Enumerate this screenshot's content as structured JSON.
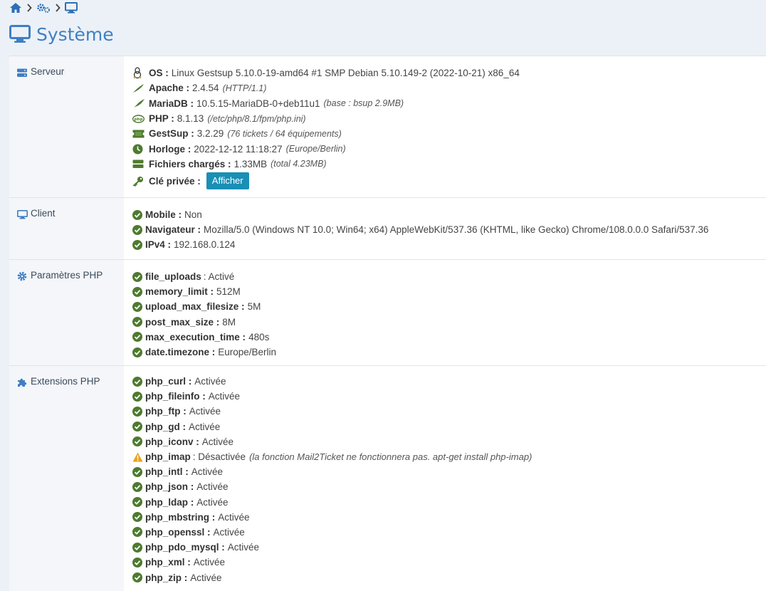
{
  "page_title": "Système",
  "sections": {
    "server": {
      "label": "Serveur",
      "rows": [
        {
          "key": "OS :",
          "value": "Linux Gestsup 5.10.0-19-amd64 #1 SMP Debian 5.10.149-2 (2022-10-21) x86_64",
          "note": "",
          "icon": "linux-icon"
        },
        {
          "key": "Apache :",
          "value": "2.4.54",
          "note": "(HTTP/1.1)",
          "icon": "apache-feather-icon"
        },
        {
          "key": "MariaDB :",
          "value": "10.5.15-MariaDB-0+deb11u1",
          "note": "(base : bsup 2.9MB)",
          "icon": "mariadb-icon"
        },
        {
          "key": "PHP :",
          "value": "8.1.13",
          "note": "(/etc/php/8.1/fpm/php.ini)",
          "icon": "php-icon"
        },
        {
          "key": "GestSup :",
          "value": "3.2.29",
          "note": "(76 tickets / 64 équipements)",
          "icon": "ticket-icon"
        },
        {
          "key": "Horloge :",
          "value": "2022-12-12 11:18:27",
          "note": "(Europe/Berlin)",
          "icon": "clock-icon"
        },
        {
          "key": "Fichiers chargés :",
          "value": "1.33MB",
          "note": "(total 4.23MB)",
          "icon": "hdd-icon"
        }
      ],
      "private_key_label": "Clé privée :",
      "show_button": "Afficher"
    },
    "client": {
      "label": "Client",
      "rows": [
        {
          "key": "Mobile :",
          "value": "Non"
        },
        {
          "key": "Navigateur :",
          "value": "Mozilla/5.0 (Windows NT 10.0; Win64; x64) AppleWebKit/537.36 (KHTML, like Gecko) Chrome/108.0.0.0 Safari/537.36"
        },
        {
          "key": "IPv4 :",
          "value": "192.168.0.124"
        }
      ]
    },
    "php_params": {
      "label": "Paramètres PHP",
      "rows": [
        {
          "key": "file_uploads",
          "value": ": Activé"
        },
        {
          "key": "memory_limit :",
          "value": "512M"
        },
        {
          "key": "upload_max_filesize :",
          "value": "5M"
        },
        {
          "key": "post_max_size :",
          "value": "8M"
        },
        {
          "key": "max_execution_time :",
          "value": "480s"
        },
        {
          "key": "date.timezone :",
          "value": "Europe/Berlin"
        }
      ]
    },
    "php_ext": {
      "label": "Extensions PHP",
      "rows": [
        {
          "key": "php_curl :",
          "value": "Activée",
          "status": "ok"
        },
        {
          "key": "php_fileinfo :",
          "value": "Activée",
          "status": "ok"
        },
        {
          "key": "php_ftp :",
          "value": "Activée",
          "status": "ok"
        },
        {
          "key": "php_gd :",
          "value": "Activée",
          "status": "ok"
        },
        {
          "key": "php_iconv :",
          "value": "Activée",
          "status": "ok"
        },
        {
          "key": "php_imap",
          "value": ": Désactivée",
          "note": "(la fonction Mail2Ticket ne fonctionnera pas. apt-get install php-imap)",
          "status": "warn"
        },
        {
          "key": "php_intl :",
          "value": "Activée",
          "status": "ok"
        },
        {
          "key": "php_json :",
          "value": "Activée",
          "status": "ok"
        },
        {
          "key": "php_ldap :",
          "value": "Activée",
          "status": "ok"
        },
        {
          "key": "php_mbstring :",
          "value": "Activée",
          "status": "ok"
        },
        {
          "key": "php_openssl :",
          "value": "Activée",
          "status": "ok"
        },
        {
          "key": "php_pdo_mysql :",
          "value": "Activée",
          "status": "ok"
        },
        {
          "key": "php_xml :",
          "value": "Activée",
          "status": "ok"
        },
        {
          "key": "php_zip :",
          "value": "Activée",
          "status": "ok"
        }
      ]
    }
  },
  "colors": {
    "accent": "#3f7fc4",
    "ok": "#4e7a2f",
    "warn": "#e8a317",
    "button": "#1a8fb5"
  }
}
